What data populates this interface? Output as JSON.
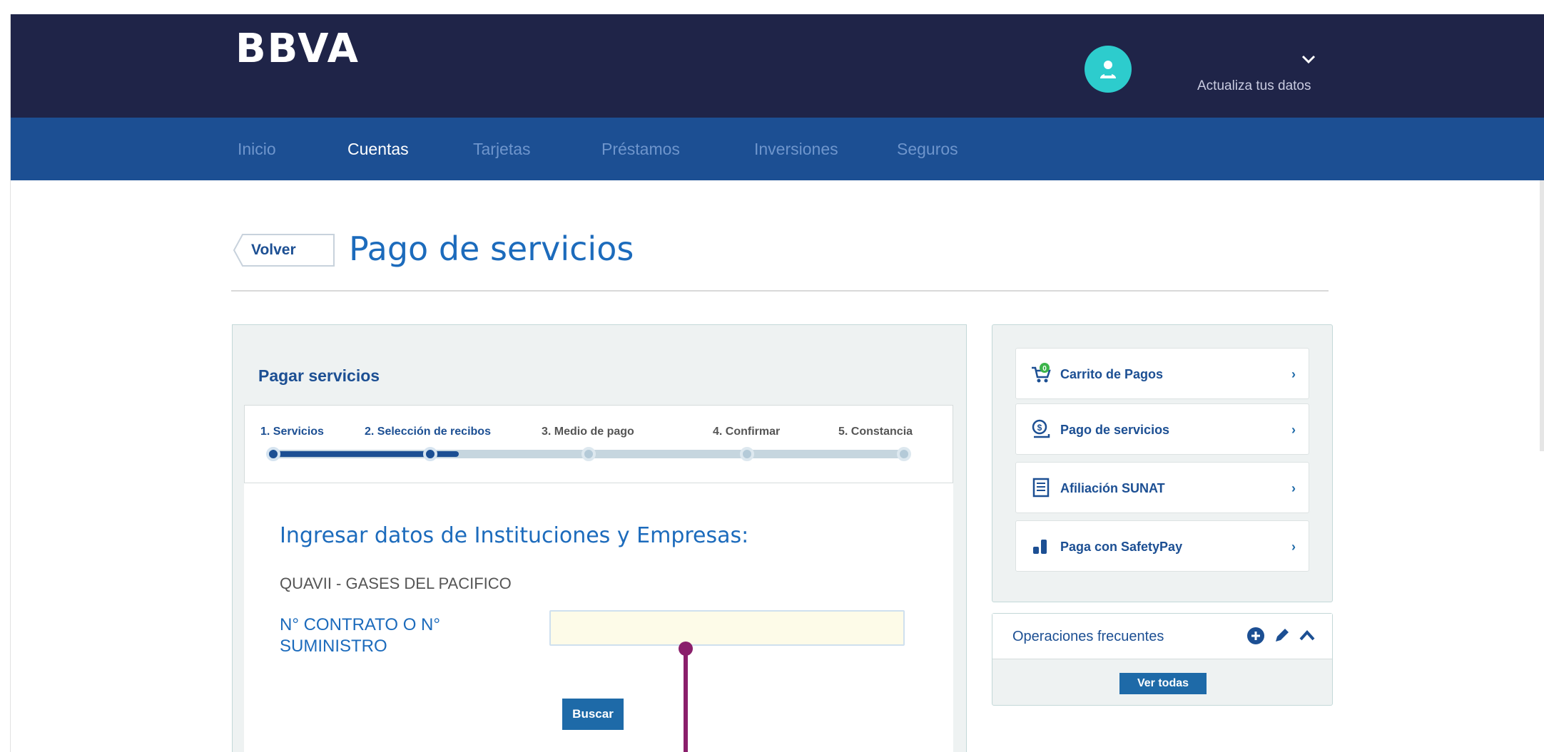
{
  "header": {
    "logo": "BBVA",
    "user_menu_label": "Actualiza tus datos"
  },
  "nav": {
    "items": [
      {
        "label": "Inicio",
        "active": false
      },
      {
        "label": "Cuentas",
        "active": true
      },
      {
        "label": "Tarjetas",
        "active": false
      },
      {
        "label": "Préstamos",
        "active": false
      },
      {
        "label": "Inversiones",
        "active": false
      },
      {
        "label": "Seguros",
        "active": false
      }
    ]
  },
  "page": {
    "back_label": "Volver",
    "title": "Pago de servicios"
  },
  "payment": {
    "panel_title": "Pagar servicios",
    "steps": [
      {
        "label": "1. Servicios",
        "status": "done"
      },
      {
        "label": "2. Selección de recibos",
        "status": "done"
      },
      {
        "label": "3. Medio de pago",
        "status": "todo"
      },
      {
        "label": "4. Confirmar",
        "status": "todo"
      },
      {
        "label": "5. Constancia",
        "status": "todo"
      }
    ],
    "form_heading": "Ingresar datos de Instituciones y Empresas:",
    "company": "QUAVII - GASES DEL PACIFICO",
    "field_label": "N° CONTRATO O N° SUMINISTRO",
    "field_value": "",
    "search_label": "Buscar"
  },
  "sidebar": {
    "items": [
      {
        "label": "Carrito de Pagos",
        "icon": "cart-icon",
        "badge": "0"
      },
      {
        "label": "Pago de servicios",
        "icon": "service-payment-icon"
      },
      {
        "label": "Afiliación SUNAT",
        "icon": "receipt-icon"
      },
      {
        "label": "Paga con SafetyPay",
        "icon": "coins-icon"
      }
    ],
    "arrow": "›"
  },
  "frequent": {
    "title": "Operaciones frecuentes",
    "view_all_label": "Ver todas"
  },
  "colors": {
    "header_bg": "#1f2448",
    "nav_bg": "#1c4f93",
    "accent": "#1c6bbc",
    "avatar": "#2dcccd",
    "pointer": "#8a1f6b"
  }
}
